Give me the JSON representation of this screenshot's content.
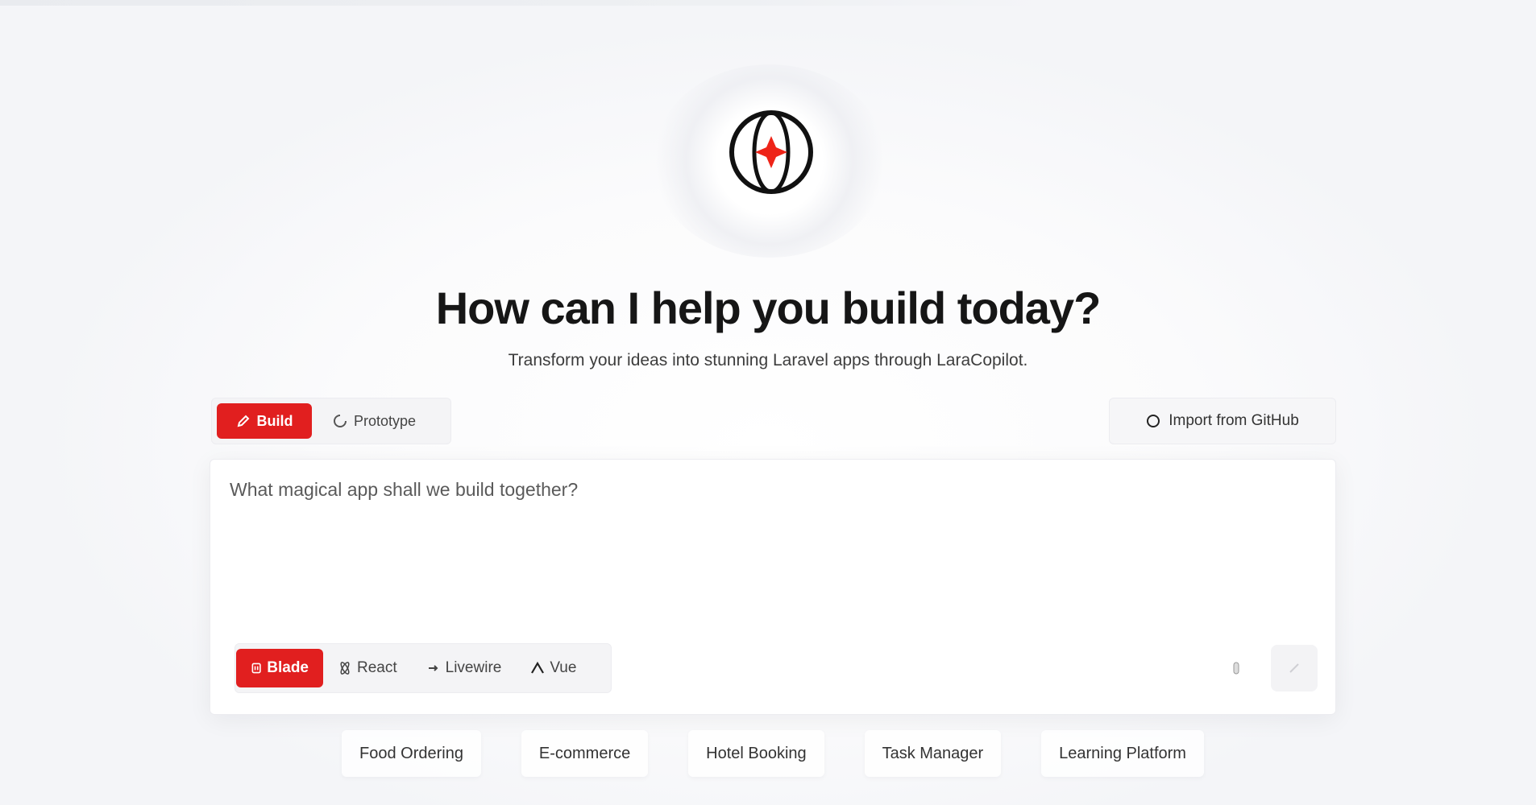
{
  "hero": {
    "logo_icon": "orbit-star-logo-icon",
    "headline": "How can I help you build today?",
    "subtitle": "Transform your ideas into stunning Laravel apps through LaraCopilot."
  },
  "mode_tabs": [
    {
      "label": "Build",
      "icon": "pencil-icon",
      "active": true
    },
    {
      "label": "Prototype",
      "icon": "loader-icon",
      "active": false
    }
  ],
  "import": {
    "label": "Import from GitHub",
    "icon": "github-icon"
  },
  "prompt": {
    "placeholder": "What magical app shall we build together?",
    "value": ""
  },
  "stack_tabs": [
    {
      "label": "Blade",
      "icon": "blade-icon",
      "active": true
    },
    {
      "label": "React",
      "icon": "react-icon",
      "active": false
    },
    {
      "label": "Livewire",
      "icon": "livewire-icon",
      "active": false
    },
    {
      "label": "Vue",
      "icon": "vue-icon",
      "active": false
    }
  ],
  "actions": {
    "mic_icon": "microphone-icon",
    "send_icon": "send-icon"
  },
  "suggestions": [
    "Food Ordering",
    "E-commerce",
    "Hotel Booking",
    "Task Manager",
    "Learning Platform"
  ],
  "colors": {
    "accent": "#e11f1f",
    "text": "#161616"
  }
}
